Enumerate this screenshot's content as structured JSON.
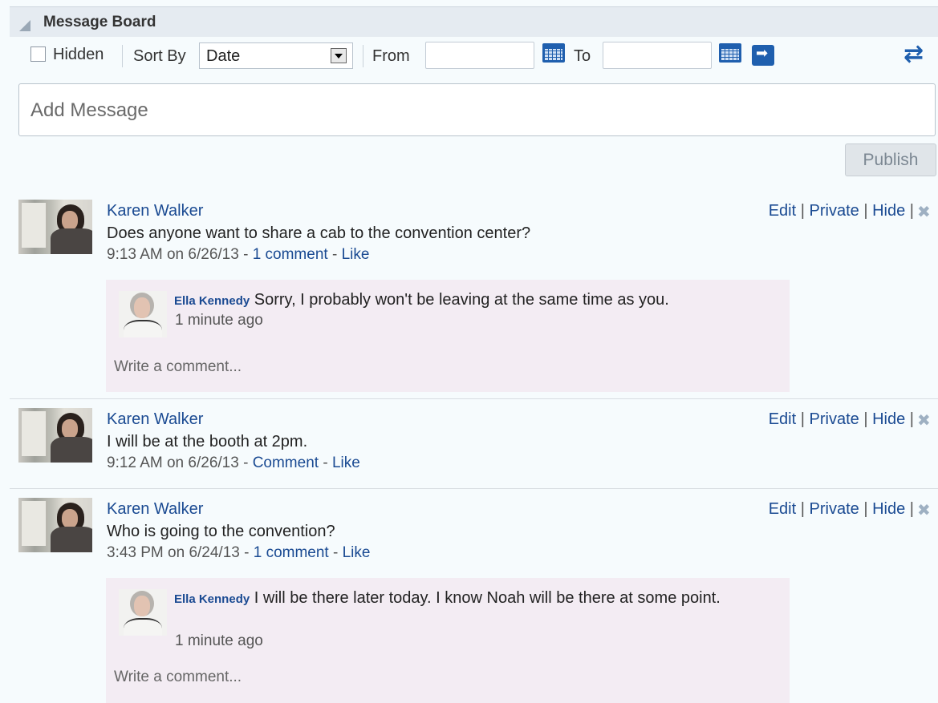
{
  "header": {
    "title": "Message Board"
  },
  "toolbar": {
    "hidden_label": "Hidden",
    "sort_label": "Sort By",
    "sort_value": "Date",
    "from_label": "From",
    "to_label": "To",
    "from_value": "",
    "to_value": ""
  },
  "composer": {
    "placeholder": "Add Message",
    "publish_label": "Publish"
  },
  "actions": {
    "edit": "Edit",
    "private": "Private",
    "hide": "Hide",
    "sep": "|"
  },
  "comment_placeholder": "Write a comment...",
  "posts": [
    {
      "author": "Karen Walker",
      "text": "Does anyone want to share a cab to the convention center?",
      "time": "9:13 AM on 6/26/13",
      "comment_link": "1 comment",
      "like_link": "Like",
      "comment": {
        "author": "Ella Kennedy",
        "text": "Sorry, I probably won't be leaving at the same time as you.",
        "time": "1 minute ago"
      }
    },
    {
      "author": "Karen Walker",
      "text": "I will be at the booth at 2pm.",
      "time": "9:12 AM on 6/26/13",
      "comment_link": "Comment",
      "like_link": "Like"
    },
    {
      "author": "Karen Walker",
      "text": "Who is going to the convention?",
      "time": "3:43 PM on 6/24/13",
      "comment_link": "1 comment",
      "like_link": "Like",
      "comment": {
        "author": "Ella Kennedy",
        "text": "I will be there later today. I know Noah will be there at some point.",
        "time": "1 minute ago"
      }
    }
  ],
  "icons": {
    "collapse": "collapse-triangle-icon",
    "calendar": "calendar-icon",
    "go": "arrow-right-icon",
    "refresh": "refresh-icon",
    "delete": "close-icon"
  }
}
